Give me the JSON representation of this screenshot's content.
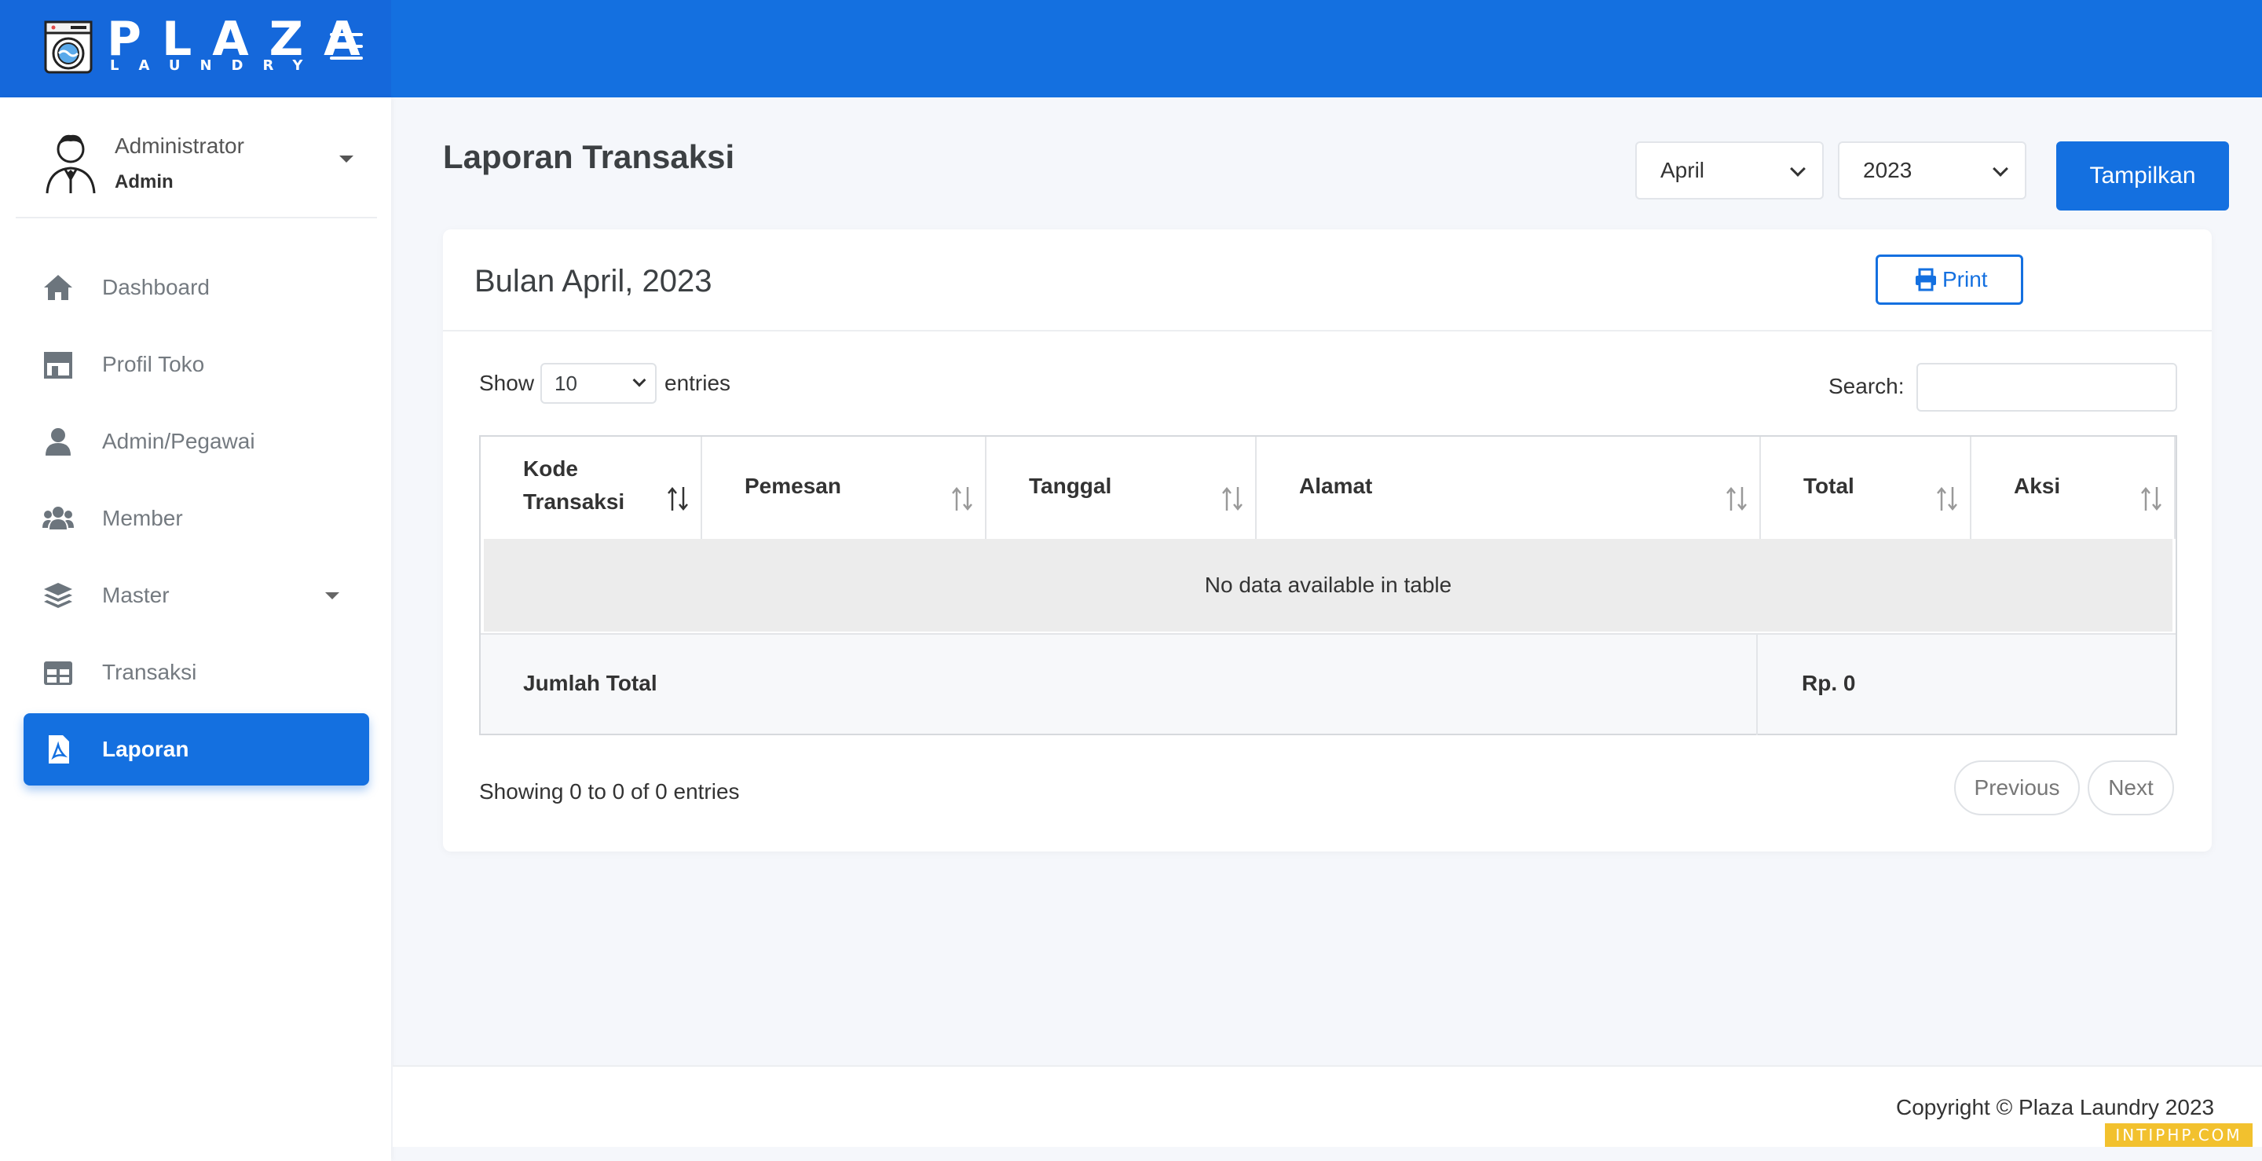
{
  "brand": {
    "title": "PLAZA",
    "subtitle": "LAUNDRY"
  },
  "user": {
    "name": "Administrator",
    "role": "Admin"
  },
  "sidebar": {
    "items": [
      {
        "label": "Dashboard",
        "icon": "home-icon"
      },
      {
        "label": "Profil Toko",
        "icon": "store-icon"
      },
      {
        "label": "Admin/Pegawai",
        "icon": "user-icon"
      },
      {
        "label": "Member",
        "icon": "users-icon"
      },
      {
        "label": "Master",
        "icon": "layers-icon"
      },
      {
        "label": "Transaksi",
        "icon": "table-icon"
      },
      {
        "label": "Laporan",
        "icon": "file-pdf-icon"
      }
    ]
  },
  "page": {
    "title": "Laporan Transaksi",
    "month_select": "April",
    "year_select": "2023",
    "show_button": "Tampilkan"
  },
  "card": {
    "title": "Bulan April, 2023",
    "print_label": "Print"
  },
  "table": {
    "show_label": "Show",
    "page_length": "10",
    "entries_label": "entries",
    "search_label": "Search:",
    "columns": [
      "Kode",
      "Transaksi",
      "Pemesan",
      "Tanggal",
      "Alamat",
      "Total",
      "Aksi"
    ],
    "empty_text": "No data available in table",
    "footer_label": "Jumlah Total",
    "footer_total": "Rp. 0",
    "info": "Showing 0 to 0 of 0 entries",
    "previous": "Previous",
    "next": "Next"
  },
  "footer": {
    "copyright": "Copyright © Plaza Laundry 2023"
  },
  "watermark": "INTIPHP.COM",
  "colors": {
    "primary": "#1470e0",
    "background": "#f5f7fb"
  }
}
